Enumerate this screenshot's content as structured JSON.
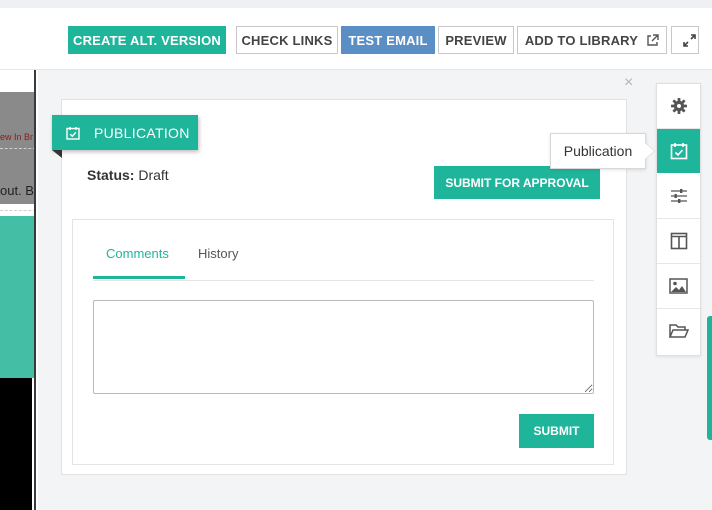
{
  "toolbar": {
    "create_alt_version": "CREATE ALT. VERSION",
    "check_links": "CHECK LINKS",
    "test_email": "TEST EMAIL",
    "preview": "PREVIEW",
    "add_to_library": "ADD TO LIBRARY"
  },
  "background": {
    "red_text": "ew In Br",
    "body_text": "out. B"
  },
  "panel": {
    "tag_label": "PUBLICATION",
    "status_label": "Status:",
    "status_value": "Draft",
    "submit_for_approval": "SUBMIT FOR APPROVAL",
    "tabs": [
      {
        "label": "Comments",
        "active": true
      },
      {
        "label": "History",
        "active": false
      }
    ],
    "comment_value": "",
    "submit": "SUBMIT",
    "close": "×"
  },
  "sidebar": {
    "items": [
      {
        "icon": "gear-icon"
      },
      {
        "icon": "calendar-check-icon",
        "active": true
      },
      {
        "icon": "sliders-icon"
      },
      {
        "icon": "columns-icon"
      },
      {
        "icon": "image-icon"
      },
      {
        "icon": "folder-open-icon"
      }
    ],
    "tooltip": "Publication"
  },
  "colors": {
    "accent": "#1fb59b",
    "blue": "#5b8ec4"
  }
}
